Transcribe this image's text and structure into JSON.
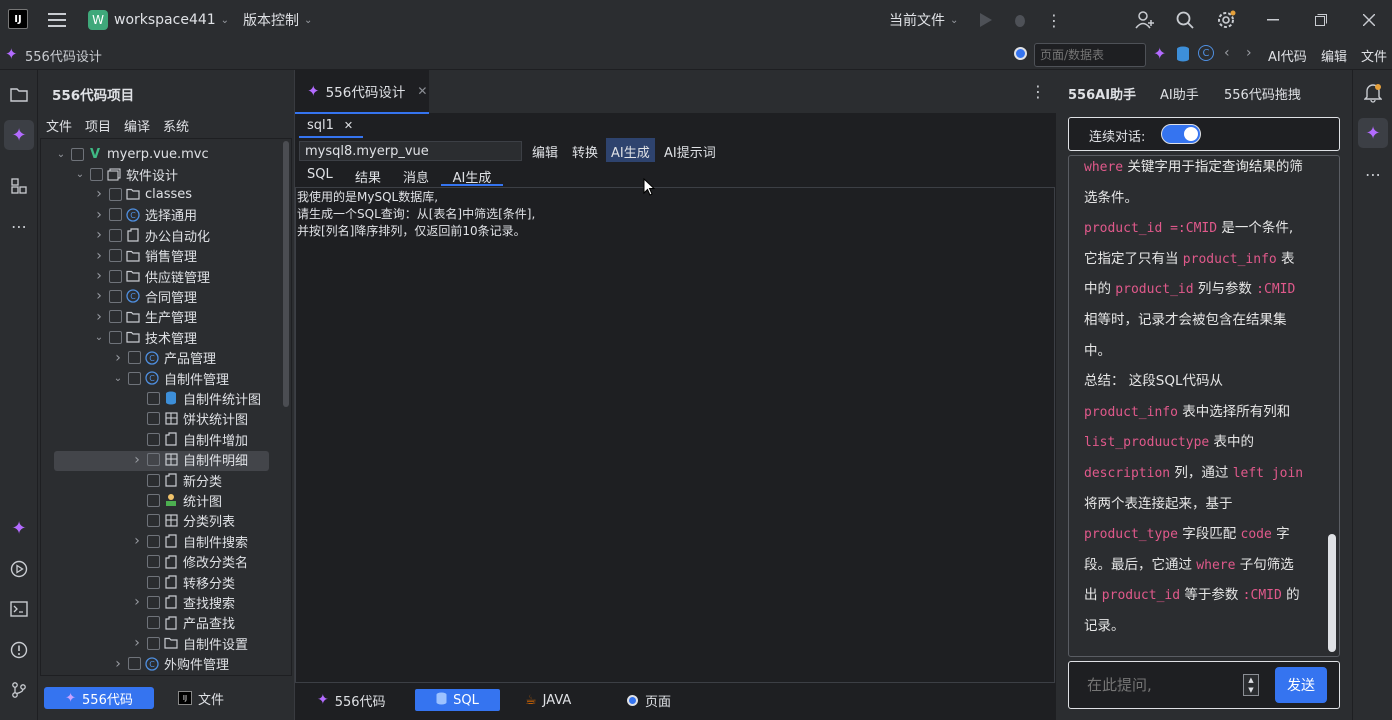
{
  "titlebar": {
    "workspace": "workspace441",
    "workspace_badge": "W",
    "vcs": "版本控制",
    "current_file": "当前文件"
  },
  "subbar": {
    "title": "556代码设计",
    "search_placeholder": "页面/数据表",
    "ai_code": "AI代码",
    "edit": "编辑",
    "file": "文件"
  },
  "project": {
    "title": "556代码项目",
    "menu": [
      "文件",
      "项目",
      "编译",
      "系统"
    ],
    "root": "myerp.vue.mvc",
    "items": [
      {
        "label": "软件设计"
      },
      {
        "label": "classes"
      },
      {
        "label": "选择通用"
      },
      {
        "label": "办公自动化"
      },
      {
        "label": "销售管理"
      },
      {
        "label": "供应链管理"
      },
      {
        "label": "合同管理"
      },
      {
        "label": "生产管理"
      },
      {
        "label": "技术管理"
      },
      {
        "label": "产品管理"
      },
      {
        "label": "自制件管理"
      },
      {
        "label": "自制件统计图"
      },
      {
        "label": "饼状统计图"
      },
      {
        "label": "自制件增加"
      },
      {
        "label": "自制件明细"
      },
      {
        "label": "新分类"
      },
      {
        "label": "统计图"
      },
      {
        "label": "分类列表"
      },
      {
        "label": "自制件搜索"
      },
      {
        "label": "修改分类名"
      },
      {
        "label": "转移分类"
      },
      {
        "label": "查找搜索"
      },
      {
        "label": "产品查找"
      },
      {
        "label": "自制件设置"
      },
      {
        "label": "外购件管理"
      }
    ],
    "bottom_tabs": [
      "556代码",
      "文件"
    ]
  },
  "editor": {
    "tab": "556代码设计",
    "subtab": "sql1",
    "db_value": "mysql8.myerp_vue",
    "actions": [
      "编辑",
      "转换",
      "AI生成",
      "AI提示词"
    ],
    "result_tabs": [
      "SQL",
      "结果",
      "消息",
      "AI生成"
    ],
    "content": [
      "我使用的是MySQL数据库,",
      "请生成一个SQL查询：从[表名]中筛选[条件],",
      "并按[列名]降序排列，仅返回前10条记录。"
    ],
    "bottom_tabs": [
      "556代码",
      "SQL",
      "JAVA",
      "页面"
    ]
  },
  "assistant": {
    "tabs": [
      "556AI助手",
      "AI助手",
      "556代码拖拽"
    ],
    "continuous_label": "连续对话:",
    "continuous_on": true,
    "input_placeholder": "在此提问,",
    "send": "发送",
    "lines": [
      [
        {
          "t": "where",
          "c": 1
        },
        {
          "t": " 关键字用于指定查询结果的筛"
        }
      ],
      [
        {
          "t": "选条件。"
        }
      ],
      [
        {
          "t": "product_id =:CMID",
          "c": 1
        },
        {
          "t": " 是一个条件,"
        }
      ],
      [
        {
          "t": "它指定了只有当 "
        },
        {
          "t": "product_info",
          "c": 1
        },
        {
          "t": " 表"
        }
      ],
      [
        {
          "t": "中的 "
        },
        {
          "t": "product_id",
          "c": 1
        },
        {
          "t": " 列与参数 "
        },
        {
          "t": ":CMID",
          "c": 1
        }
      ],
      [
        {
          "t": "相等时，记录才会被包含在结果集"
        }
      ],
      [
        {
          "t": "中。"
        }
      ],
      [
        {
          "t": "总结： 这段SQL代码从"
        }
      ],
      [
        {
          "t": "product_info",
          "c": 1
        },
        {
          "t": " 表中选择所有列和"
        }
      ],
      [
        {
          "t": "list_produuctype",
          "c": 1
        },
        {
          "t": " 表中的"
        }
      ],
      [
        {
          "t": "description",
          "c": 1
        },
        {
          "t": " 列，通过 "
        },
        {
          "t": "left join",
          "c": 1
        }
      ],
      [
        {
          "t": "将两个表连接起来，基于"
        }
      ],
      [
        {
          "t": "product_type",
          "c": 1
        },
        {
          "t": " 字段匹配 "
        },
        {
          "t": "code",
          "c": 1
        },
        {
          "t": " 字"
        }
      ],
      [
        {
          "t": "段。最后，它通过 "
        },
        {
          "t": "where",
          "c": 1
        },
        {
          "t": " 子句筛选"
        }
      ],
      [
        {
          "t": "出 "
        },
        {
          "t": "product_id",
          "c": 1
        },
        {
          "t": " 等于参数 "
        },
        {
          "t": ":CMID",
          "c": 1
        },
        {
          "t": " 的"
        }
      ],
      [
        {
          "t": "记录。"
        }
      ]
    ]
  },
  "colors": {
    "accent": "#3574f0",
    "code": "#e0598b",
    "brand_purple": "#b36bff"
  }
}
